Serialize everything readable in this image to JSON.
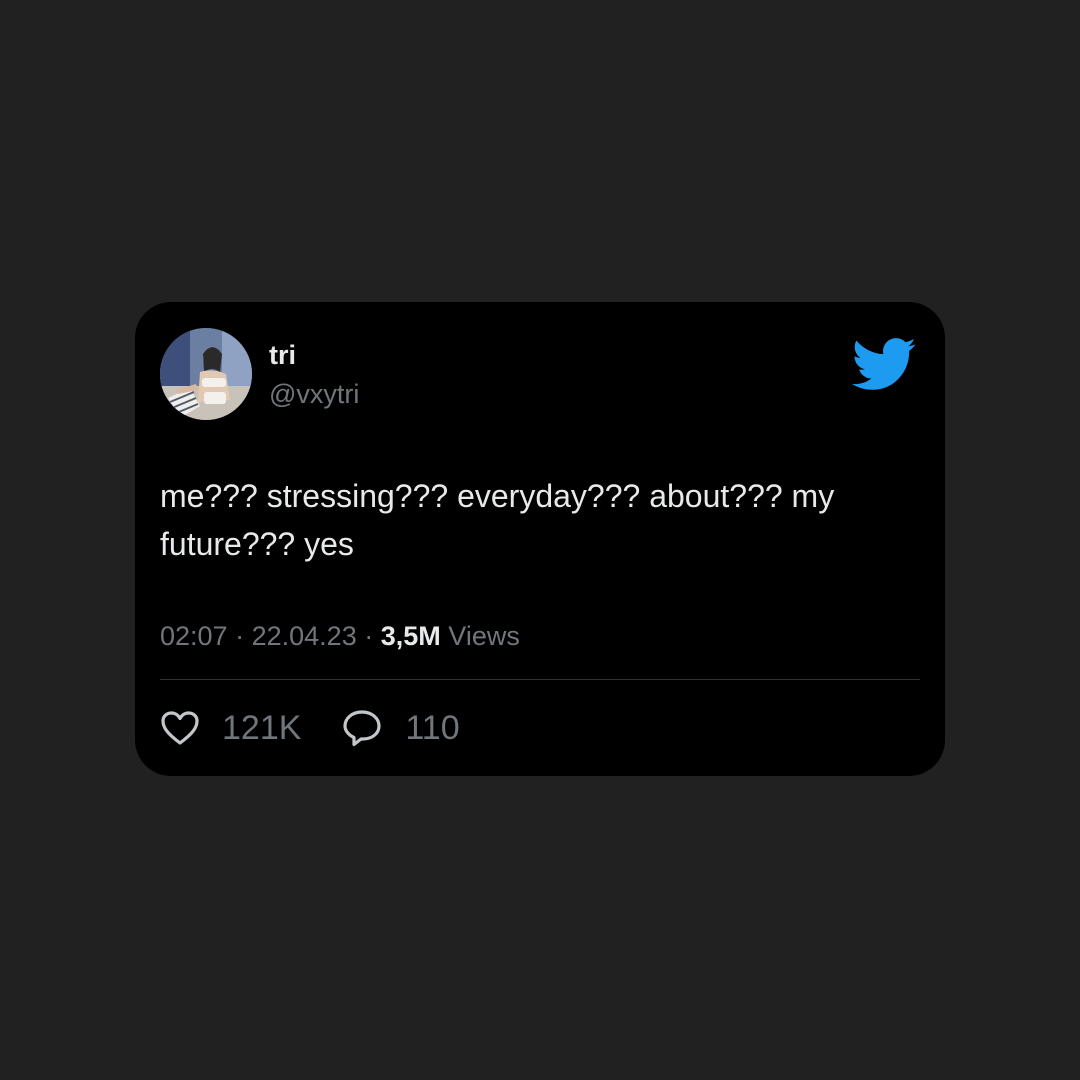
{
  "tweet": {
    "display_name": "tri",
    "handle": "@vxytri",
    "text": "me??? stressing??? everyday??? about??? my future??? yes",
    "time": "02:07",
    "date": "22.04.23",
    "views_count": "3,5M",
    "views_label": "Views",
    "separator": "·"
  },
  "actions": {
    "likes": "121K",
    "replies": "110"
  },
  "icons": {
    "brand": "twitter-bird-icon",
    "like": "heart-icon",
    "reply": "speech-bubble-icon"
  },
  "colors": {
    "page_background": "#212121",
    "card_background": "#000000",
    "primary_text": "#e7e9ea",
    "secondary_text": "#71767b",
    "brand_blue": "#1d9bf0"
  }
}
